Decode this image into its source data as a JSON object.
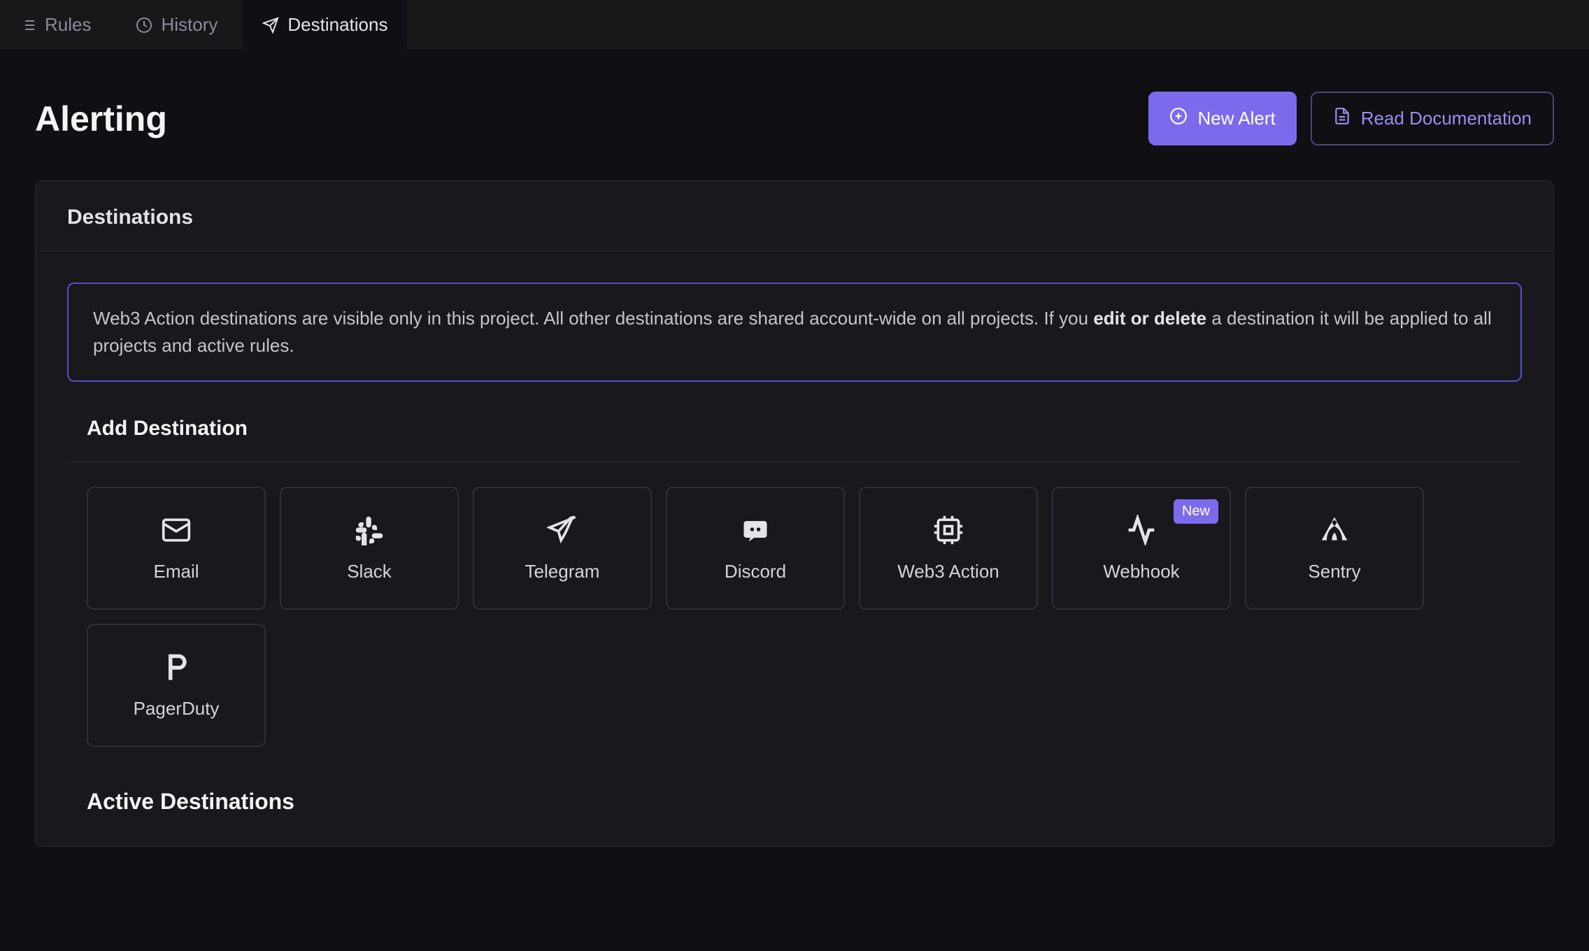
{
  "tabs": [
    {
      "label": "Rules",
      "icon": "list"
    },
    {
      "label": "History",
      "icon": "clock"
    },
    {
      "label": "Destinations",
      "icon": "send",
      "active": true
    }
  ],
  "page_title": "Alerting",
  "header": {
    "new_alert": "New Alert",
    "read_docs": "Read Documentation"
  },
  "card": {
    "title": "Destinations",
    "info_prefix": "Web3 Action destinations are visible only in this project. All other destinations are shared account-wide on all projects. If you ",
    "info_bold": "edit or delete",
    "info_suffix": " a destination it will be applied to all projects and active rules.",
    "add_title": "Add Destination",
    "active_title": "Active Destinations"
  },
  "destinations": [
    {
      "label": "Email",
      "icon": "mail"
    },
    {
      "label": "Slack",
      "icon": "slack"
    },
    {
      "label": "Telegram",
      "icon": "telegram"
    },
    {
      "label": "Discord",
      "icon": "discord"
    },
    {
      "label": "Web3 Action",
      "icon": "cpu"
    },
    {
      "label": "Webhook",
      "icon": "activity",
      "badge": "New"
    },
    {
      "label": "Sentry",
      "icon": "sentry"
    },
    {
      "label": "PagerDuty",
      "icon": "pagerduty"
    }
  ]
}
